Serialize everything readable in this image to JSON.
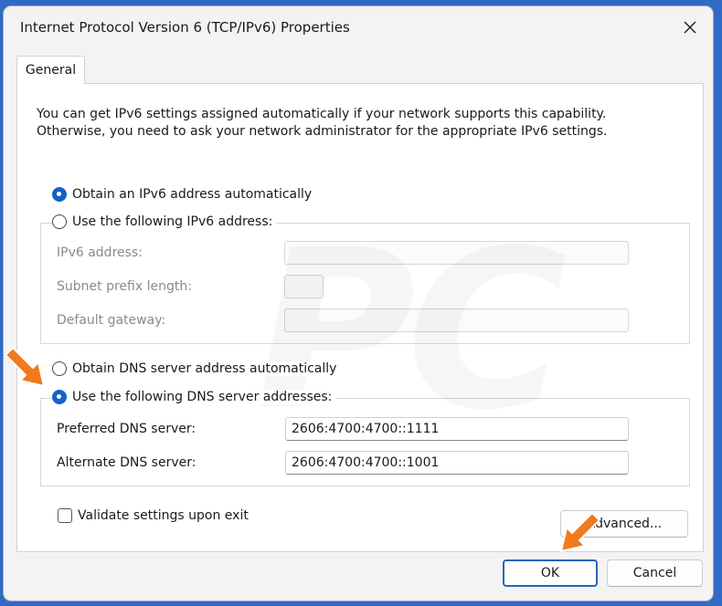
{
  "window": {
    "title": "Internet Protocol Version 6 (TCP/IPv6) Properties",
    "close_icon": "close-icon"
  },
  "tabs": [
    {
      "label": "General",
      "selected": true
    }
  ],
  "description": {
    "line1": "You can get IPv6 settings assigned automatically if your network supports this capability.",
    "line2": "Otherwise, you need to ask your network administrator for the appropriate IPv6 settings."
  },
  "ip_section": {
    "auto_label": "Obtain an IPv6 address automatically",
    "auto_selected": true,
    "manual_label": "Use the following IPv6 address:",
    "manual_selected": false,
    "fields": [
      {
        "label": "IPv6 address:",
        "value": ""
      },
      {
        "label": "Subnet prefix length:",
        "value": ""
      },
      {
        "label": "Default gateway:",
        "value": ""
      }
    ]
  },
  "dns_section": {
    "auto_label": "Obtain DNS server address automatically",
    "auto_selected": false,
    "manual_label": "Use the following DNS server addresses:",
    "manual_selected": true,
    "preferred_label": "Preferred DNS server:",
    "preferred_value": "2606:4700:4700::1111",
    "alternate_label": "Alternate DNS server:",
    "alternate_value": "2606:4700:4700::1001"
  },
  "validate": {
    "label": "Validate settings upon exit",
    "checked": false
  },
  "buttons": {
    "advanced": "Advanced...",
    "ok": "OK",
    "cancel": "Cancel"
  },
  "colors": {
    "accent": "#1363c7",
    "arrow": "#f07a1d"
  }
}
